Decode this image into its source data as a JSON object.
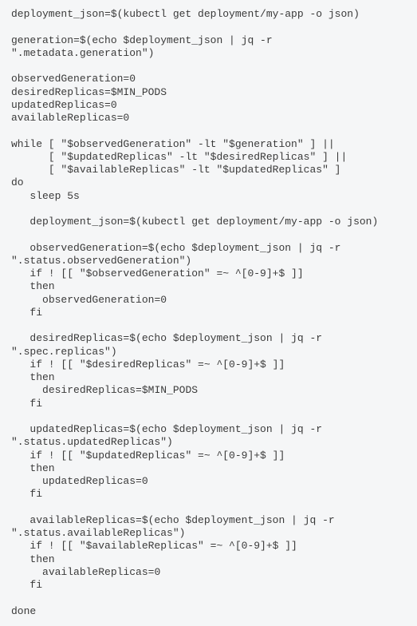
{
  "code": {
    "lines": [
      "deployment_json=$(kubectl get deployment/my-app -o json)",
      "",
      "generation=$(echo $deployment_json | jq -r \".metadata.generation\")",
      "",
      "observedGeneration=0",
      "desiredReplicas=$MIN_PODS",
      "updatedReplicas=0",
      "availableReplicas=0",
      "",
      "while [ \"$observedGeneration\" -lt \"$generation\" ] ||",
      "      [ \"$updatedReplicas\" -lt \"$desiredReplicas\" ] ||",
      "      [ \"$availableReplicas\" -lt \"$updatedReplicas\" ]",
      "do",
      "   sleep 5s",
      "",
      "   deployment_json=$(kubectl get deployment/my-app -o json)",
      "",
      "   observedGeneration=$(echo $deployment_json | jq -r \".status.observedGeneration\")",
      "   if ! [[ \"$observedGeneration\" =~ ^[0-9]+$ ]]",
      "   then",
      "     observedGeneration=0",
      "   fi",
      "",
      "   desiredReplicas=$(echo $deployment_json | jq -r \".spec.replicas\")",
      "   if ! [[ \"$desiredReplicas\" =~ ^[0-9]+$ ]]",
      "   then",
      "     desiredReplicas=$MIN_PODS",
      "   fi",
      "",
      "   updatedReplicas=$(echo $deployment_json | jq -r \".status.updatedReplicas\")",
      "   if ! [[ \"$updatedReplicas\" =~ ^[0-9]+$ ]]",
      "   then",
      "     updatedReplicas=0",
      "   fi",
      "",
      "   availableReplicas=$(echo $deployment_json | jq -r \".status.availableReplicas\")",
      "   if ! [[ \"$availableReplicas\" =~ ^[0-9]+$ ]]",
      "   then",
      "     availableReplicas=0",
      "   fi",
      "",
      "done"
    ]
  }
}
